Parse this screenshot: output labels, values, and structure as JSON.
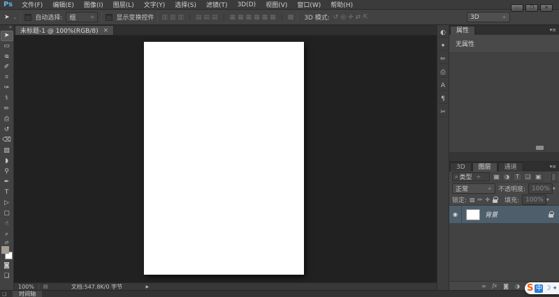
{
  "titlebar": {
    "logo": "Ps",
    "menus": [
      {
        "name": "menu-file",
        "label": "文件(F)"
      },
      {
        "name": "menu-edit",
        "label": "编辑(E)"
      },
      {
        "name": "menu-image",
        "label": "图像(I)"
      },
      {
        "name": "menu-layer",
        "label": "图层(L)"
      },
      {
        "name": "menu-type",
        "label": "文字(Y)"
      },
      {
        "name": "menu-select",
        "label": "选择(S)"
      },
      {
        "name": "menu-filter",
        "label": "滤镜(T)"
      },
      {
        "name": "menu-3d",
        "label": "3D(D)"
      },
      {
        "name": "menu-view",
        "label": "视图(V)"
      },
      {
        "name": "menu-window",
        "label": "窗口(W)"
      },
      {
        "name": "menu-help",
        "label": "帮助(H)"
      }
    ],
    "window_controls": {
      "minimize": "–",
      "restore": "❒",
      "close": "✕"
    }
  },
  "options_bar": {
    "move_tool_glyph": "➤",
    "move_tool_caret": "⌄",
    "auto_select_label": "自动选择:",
    "auto_select_value": "组",
    "caret_updown": "÷",
    "caret_down": "▾",
    "show_transform_label": "显示变换控件",
    "align_icons": [
      {
        "name": "align-left-edges-icon",
        "glyph": "▥"
      },
      {
        "name": "align-horizontal-centers-icon",
        "glyph": "▥"
      },
      {
        "name": "align-right-edges-icon",
        "glyph": "▥"
      },
      {
        "name": "align-top-edges-icon",
        "glyph": "▤",
        "cls": "grp"
      },
      {
        "name": "align-vertical-centers-icon",
        "glyph": "▤"
      },
      {
        "name": "align-bottom-edges-icon",
        "glyph": "▤"
      },
      {
        "name": "distribute-top-edges-icon",
        "glyph": "▦",
        "cls": "grp"
      },
      {
        "name": "distribute-vertical-centers-icon",
        "glyph": "▦"
      },
      {
        "name": "distribute-bottom-edges-icon",
        "glyph": "▦"
      },
      {
        "name": "distribute-left-edges-icon",
        "glyph": "▦"
      },
      {
        "name": "distribute-horizontal-centers-icon",
        "glyph": "▦"
      },
      {
        "name": "distribute-right-edges-icon",
        "glyph": "▦"
      },
      {
        "name": "auto-align-layers-icon",
        "glyph": "▩",
        "cls": "grp"
      }
    ],
    "mode_3d_label": "3D 模式:",
    "mode_3d_icons": [
      {
        "name": "3d-rotate-tool-icon",
        "glyph": "↺"
      },
      {
        "name": "3d-roll-tool-icon",
        "glyph": "◎"
      },
      {
        "name": "3d-drag-tool-icon",
        "glyph": "✛"
      },
      {
        "name": "3d-slide-tool-icon",
        "glyph": "⇄"
      },
      {
        "name": "3d-scale-tool-icon",
        "glyph": "⇱"
      }
    ],
    "workspace_value": "3D"
  },
  "document": {
    "tab_title": "未标题-1 @ 100%(RGB/8)",
    "tab_close": "×"
  },
  "toolbar": {
    "collapse_glyph": "»",
    "tools": [
      {
        "name": "move-tool",
        "glyph": "➤",
        "cls": "selected"
      },
      {
        "name": "rectangular-marquee-tool",
        "glyph": "▭"
      },
      {
        "name": "lasso-tool",
        "glyph": "ҩ"
      },
      {
        "name": "quick-selection-tool",
        "glyph": "✐"
      },
      {
        "name": "crop-tool",
        "glyph": "⌗"
      },
      {
        "name": "eyedropper-tool",
        "glyph": "✑"
      },
      {
        "name": "spot-healing-brush-tool",
        "glyph": "⚕"
      },
      {
        "name": "brush-tool",
        "glyph": "✏"
      },
      {
        "name": "clone-stamp-tool",
        "glyph": "⎙"
      },
      {
        "name": "history-brush-tool",
        "glyph": "↺"
      },
      {
        "name": "eraser-tool",
        "glyph": "⌫"
      },
      {
        "name": "gradient-tool",
        "glyph": "▧"
      },
      {
        "name": "blur-tool",
        "glyph": "◗"
      },
      {
        "name": "dodge-tool",
        "glyph": "⚲"
      },
      {
        "name": "pen-tool",
        "glyph": "✒"
      },
      {
        "name": "type-tool",
        "glyph": "T"
      },
      {
        "name": "path-selection-tool",
        "glyph": "▷"
      },
      {
        "name": "rectangle-tool",
        "glyph": "▢"
      },
      {
        "name": "hand-tool",
        "glyph": "☝"
      },
      {
        "name": "zoom-tool",
        "glyph": "⌕"
      }
    ],
    "swatch_reset_glyph": "⇄",
    "foreground_color": "#a79e91",
    "background_color": "#ffffff",
    "quick_mask_glyph": "◙",
    "screen_mode_glyph": "❏"
  },
  "dock": {
    "icons": [
      {
        "name": "adjustments-panel-icon",
        "glyph": "◐"
      },
      {
        "name": "styles-panel-icon",
        "glyph": "✦"
      },
      {
        "name": "brush-panel-icon",
        "glyph": "✏"
      },
      {
        "name": "clone-source-panel-icon",
        "glyph": "⎙"
      },
      {
        "name": "character-panel-icon",
        "glyph": "A"
      },
      {
        "name": "paragraph-panel-icon",
        "glyph": "¶"
      },
      {
        "name": "tool-presets-panel-icon",
        "glyph": "✂"
      }
    ]
  },
  "properties_panel": {
    "tab": "属性",
    "menu_glyph": "▾≡",
    "empty_text": "无属性"
  },
  "layers_panel": {
    "tabs": [
      {
        "name": "tab-3d",
        "label": "3D",
        "cls": "inactive"
      },
      {
        "name": "tab-layers",
        "label": "图层"
      },
      {
        "name": "tab-channels",
        "label": "通道",
        "cls": "inactive"
      }
    ],
    "menu_glyph": "▾≡",
    "search_glyph": "⌕",
    "filter_type_label": "类型",
    "filter_caret": "÷",
    "filter_icons": [
      {
        "name": "filter-pixel-layers-icon",
        "glyph": "▦"
      },
      {
        "name": "filter-adjustment-layers-icon",
        "glyph": "◑"
      },
      {
        "name": "filter-type-layers-icon",
        "glyph": "T"
      },
      {
        "name": "filter-group-layers-icon",
        "glyph": "❏"
      },
      {
        "name": "filter-smart-objects-icon",
        "glyph": "▣"
      }
    ],
    "blend_mode_value": "正常",
    "opacity_label": "不透明度:",
    "opacity_value": "100%",
    "lock_label": "锁定:",
    "lock_icons": [
      {
        "name": "lock-transparent-pixels-icon",
        "glyph": "▨"
      },
      {
        "name": "lock-image-pixels-icon",
        "glyph": "✏"
      },
      {
        "name": "lock-position-icon",
        "glyph": "✛"
      }
    ],
    "fill_label": "填充:",
    "fill_value": "100%",
    "layer": {
      "name": "背景",
      "eye_glyph": "◉"
    },
    "bottom_icons": [
      {
        "name": "link-layers-icon",
        "glyph": "∞"
      },
      {
        "name": "layer-effects-icon",
        "glyph": "ƒx",
        "cls": "fx"
      },
      {
        "name": "add-layer-mask-icon",
        "glyph": "◙"
      },
      {
        "name": "new-adjustment-layer-icon",
        "glyph": "◑"
      },
      {
        "name": "new-group-icon",
        "glyph": "❏"
      },
      {
        "name": "delete-layer-icon",
        "glyph": "▯"
      }
    ]
  },
  "status_bar": {
    "zoom": "100%",
    "doc_icon": "▤",
    "doc_info": "文档:547.8K/0 字节",
    "expand": "▶"
  },
  "timeline": {
    "corner_glyph": "❏",
    "tab": "时间轴"
  },
  "ime": {
    "logo": "S",
    "lang": "中",
    "moon": "☽",
    "extra": "✦"
  },
  "colors": {
    "selection_blue_gray": "#4f5e6b",
    "foreground_swatch": "#a79e91",
    "ime_logo_orange": "#ff5a00",
    "ime_blue": "#2a7fd4",
    "ps_logo_blue": "#5fb2e6"
  }
}
